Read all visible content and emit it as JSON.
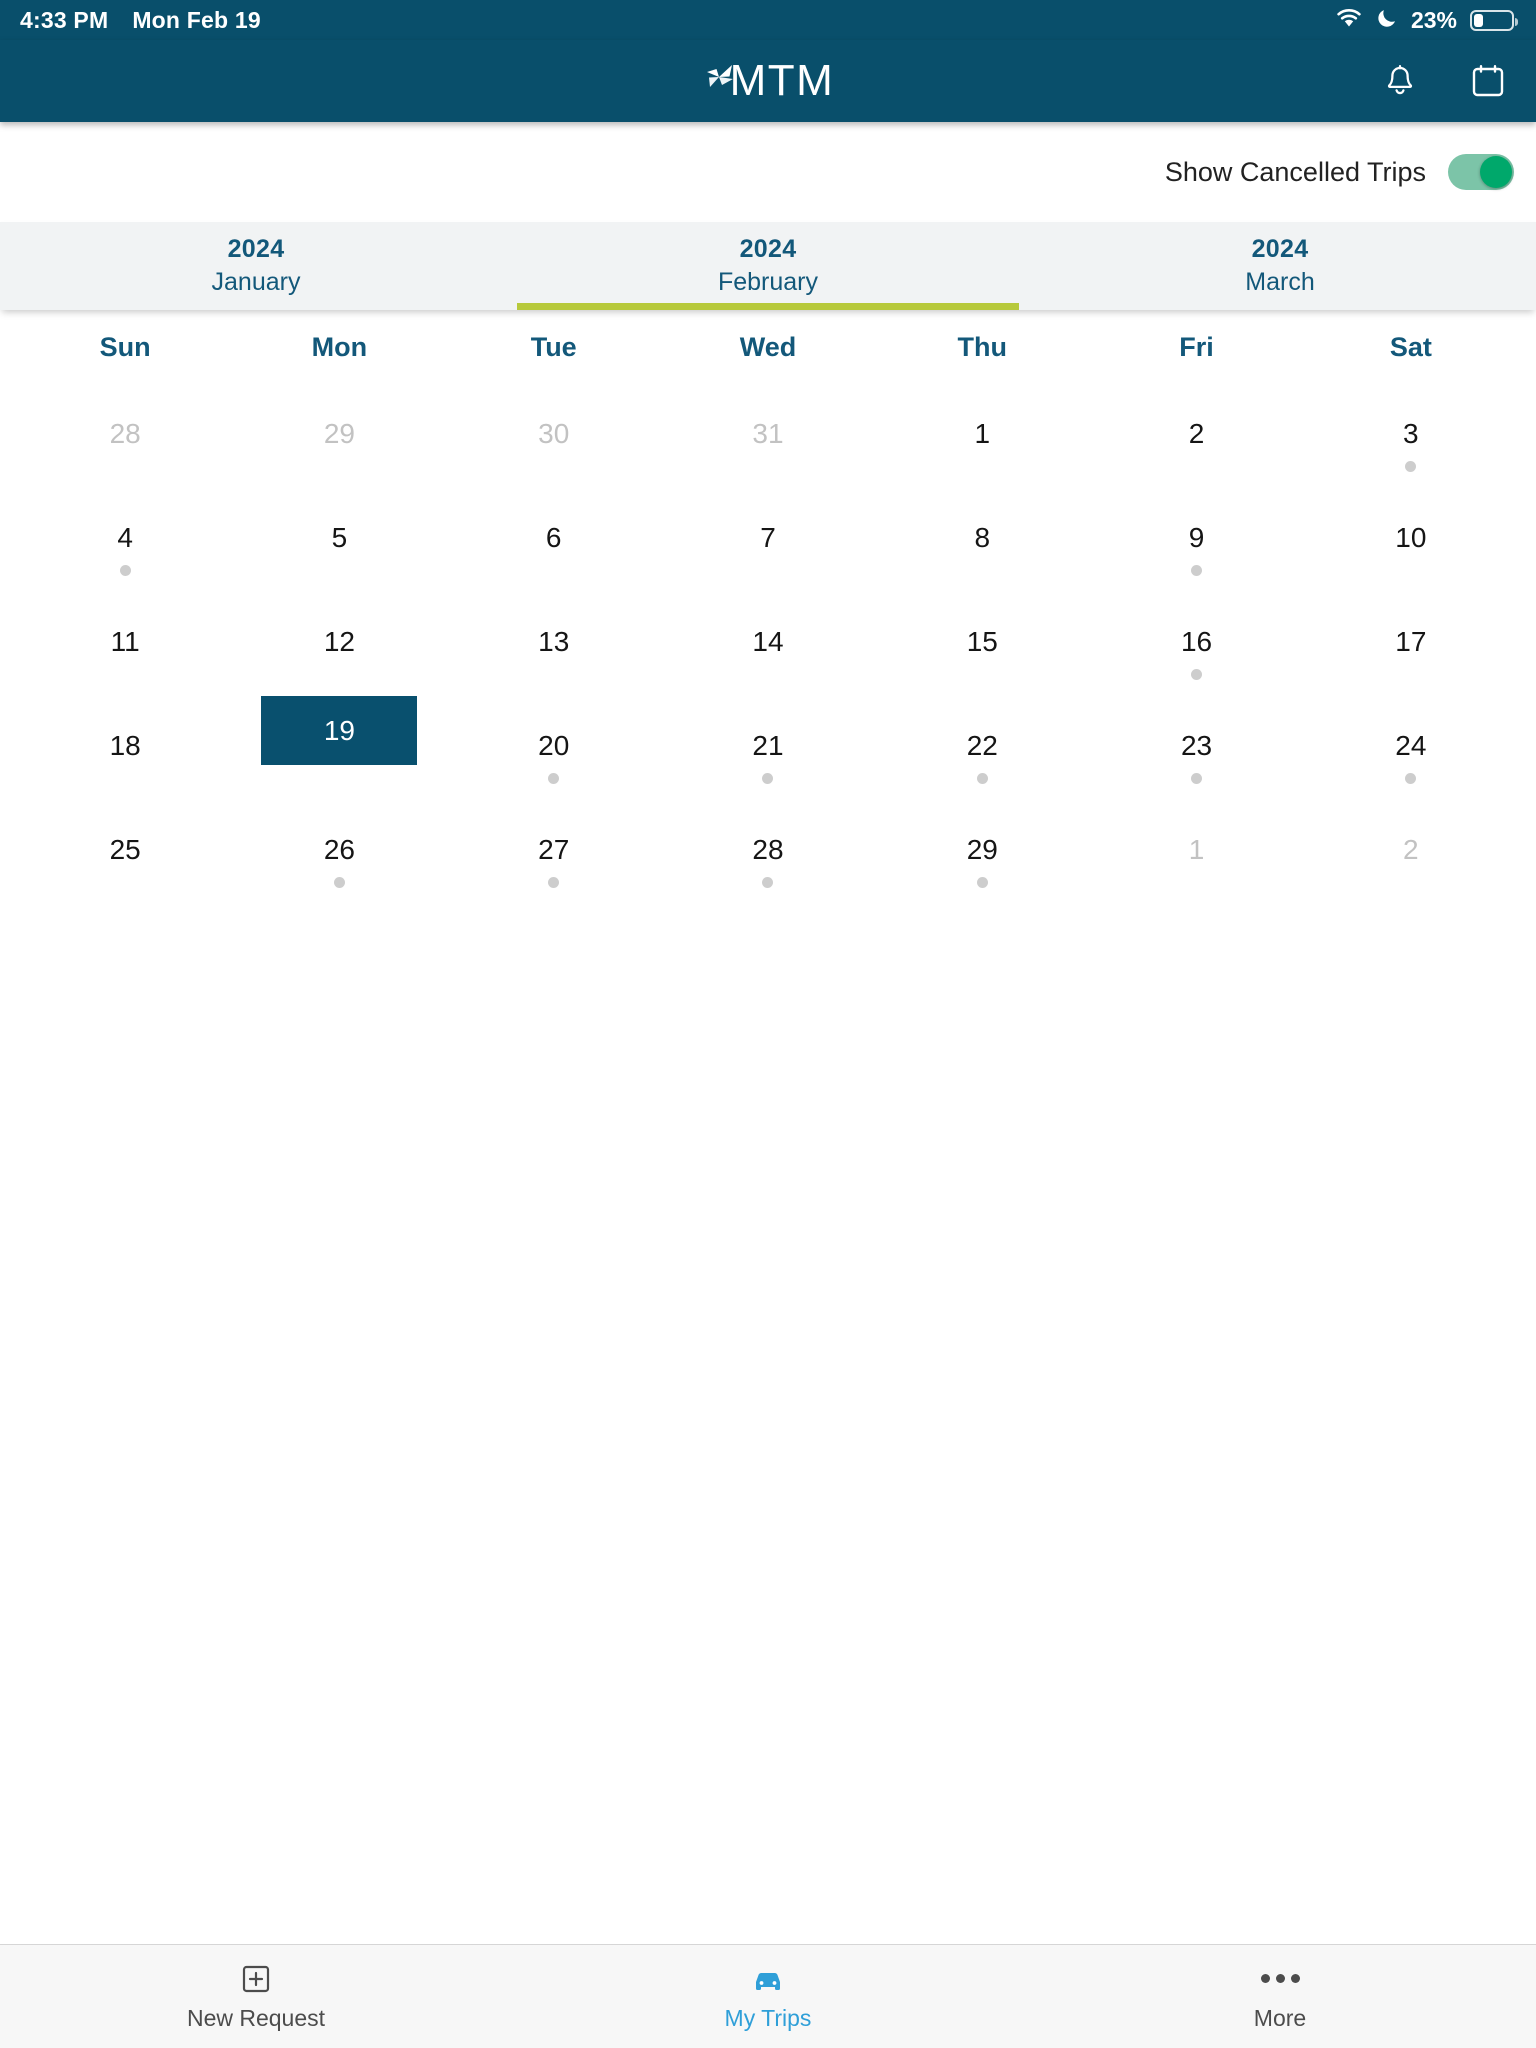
{
  "status_bar": {
    "time": "4:33 PM",
    "date": "Mon Feb 19",
    "battery_percent": "23%",
    "icons": [
      "wifi-icon",
      "do-not-disturb-moon-icon",
      "battery-icon"
    ]
  },
  "header": {
    "logo_text": "MTM",
    "logo_mark": "pinwheel-icon",
    "notifications_icon": "bell-icon",
    "calendar_icon": "calendar-icon"
  },
  "filter": {
    "toggle_label": "Show Cancelled Trips",
    "toggle_on": true
  },
  "month_tabs": [
    {
      "year": "2024",
      "month": "January",
      "active": false
    },
    {
      "year": "2024",
      "month": "February",
      "active": true
    },
    {
      "year": "2024",
      "month": "March",
      "active": false
    }
  ],
  "calendar": {
    "day_headers": [
      "Sun",
      "Mon",
      "Tue",
      "Wed",
      "Thu",
      "Fri",
      "Sat"
    ],
    "weeks": [
      [
        {
          "num": "28",
          "muted": true,
          "dot": false,
          "selected": false
        },
        {
          "num": "29",
          "muted": true,
          "dot": false,
          "selected": false
        },
        {
          "num": "30",
          "muted": true,
          "dot": false,
          "selected": false
        },
        {
          "num": "31",
          "muted": true,
          "dot": false,
          "selected": false
        },
        {
          "num": "1",
          "muted": false,
          "dot": false,
          "selected": false
        },
        {
          "num": "2",
          "muted": false,
          "dot": false,
          "selected": false
        },
        {
          "num": "3",
          "muted": false,
          "dot": true,
          "selected": false
        }
      ],
      [
        {
          "num": "4",
          "muted": false,
          "dot": true,
          "selected": false
        },
        {
          "num": "5",
          "muted": false,
          "dot": false,
          "selected": false
        },
        {
          "num": "6",
          "muted": false,
          "dot": false,
          "selected": false
        },
        {
          "num": "7",
          "muted": false,
          "dot": false,
          "selected": false
        },
        {
          "num": "8",
          "muted": false,
          "dot": false,
          "selected": false
        },
        {
          "num": "9",
          "muted": false,
          "dot": true,
          "selected": false
        },
        {
          "num": "10",
          "muted": false,
          "dot": false,
          "selected": false
        }
      ],
      [
        {
          "num": "11",
          "muted": false,
          "dot": false,
          "selected": false
        },
        {
          "num": "12",
          "muted": false,
          "dot": false,
          "selected": false
        },
        {
          "num": "13",
          "muted": false,
          "dot": false,
          "selected": false
        },
        {
          "num": "14",
          "muted": false,
          "dot": false,
          "selected": false
        },
        {
          "num": "15",
          "muted": false,
          "dot": false,
          "selected": false
        },
        {
          "num": "16",
          "muted": false,
          "dot": true,
          "selected": false
        },
        {
          "num": "17",
          "muted": false,
          "dot": false,
          "selected": false
        }
      ],
      [
        {
          "num": "18",
          "muted": false,
          "dot": false,
          "selected": false
        },
        {
          "num": "19",
          "muted": false,
          "dot": false,
          "selected": true
        },
        {
          "num": "20",
          "muted": false,
          "dot": true,
          "selected": false
        },
        {
          "num": "21",
          "muted": false,
          "dot": true,
          "selected": false
        },
        {
          "num": "22",
          "muted": false,
          "dot": true,
          "selected": false
        },
        {
          "num": "23",
          "muted": false,
          "dot": true,
          "selected": false
        },
        {
          "num": "24",
          "muted": false,
          "dot": true,
          "selected": false
        }
      ],
      [
        {
          "num": "25",
          "muted": false,
          "dot": false,
          "selected": false
        },
        {
          "num": "26",
          "muted": false,
          "dot": true,
          "selected": false
        },
        {
          "num": "27",
          "muted": false,
          "dot": true,
          "selected": false
        },
        {
          "num": "28",
          "muted": false,
          "dot": true,
          "selected": false
        },
        {
          "num": "29",
          "muted": false,
          "dot": true,
          "selected": false
        },
        {
          "num": "1",
          "muted": true,
          "dot": false,
          "selected": false
        },
        {
          "num": "2",
          "muted": true,
          "dot": false,
          "selected": false
        }
      ]
    ]
  },
  "tab_bar": [
    {
      "label": "New Request",
      "icon": "plus-square-icon",
      "active": false
    },
    {
      "label": "My Trips",
      "icon": "car-icon",
      "active": true
    },
    {
      "label": "More",
      "icon": "ellipsis-icon",
      "active": false
    }
  ],
  "colors": {
    "brand_dark_teal": "#094f6b",
    "accent_green": "#b7c93b",
    "active_tab_blue": "#2f9fd8",
    "toggle_on_green": "#00a86b"
  }
}
